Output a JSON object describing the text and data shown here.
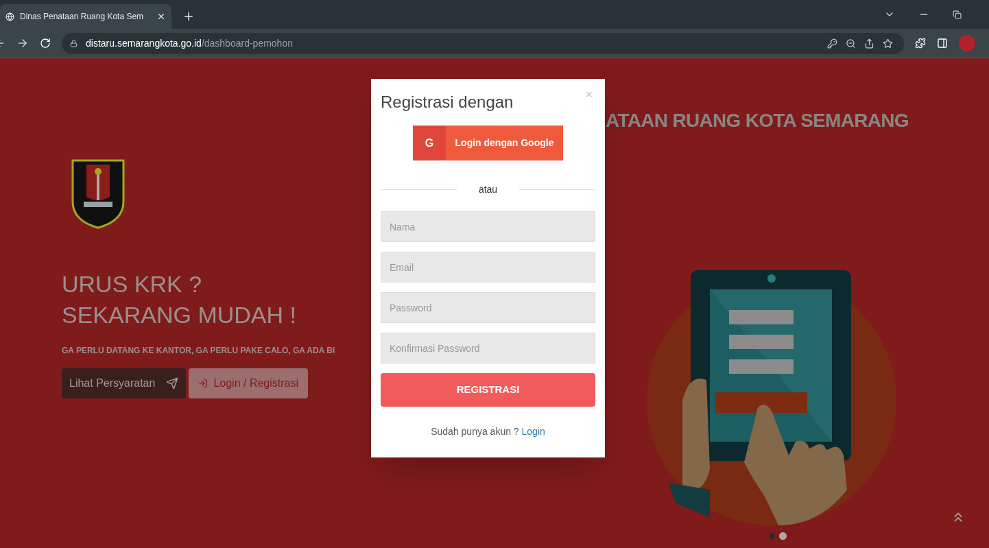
{
  "browser": {
    "tab": {
      "title": "Dinas Penataan Ruang Kota Sem"
    },
    "address": {
      "domain": "distaru.semarangkota.go.id",
      "path": "/dashboard-pemohon"
    }
  },
  "page": {
    "heading_lines": [
      "URUS KRK ?",
      "SEKARANG MUDAH !"
    ],
    "tagline": "GA PERLU DATANG KE KANTOR, GA PERLU PAKE CALO, GA ADA BI",
    "buttons": [
      {
        "label": "Lihat Persyaratan",
        "kind": "primary"
      },
      {
        "label": "Login / Registrasi",
        "kind": "secondary"
      }
    ],
    "title": "ATAAN RUANG KOTA SEMARANG",
    "carousel": [
      {
        "selected": false
      },
      {
        "selected": true
      }
    ]
  },
  "modal": {
    "title": "Registrasi dengan",
    "close": "×",
    "google_button": {
      "icon": "G",
      "label": "Login dengan Google"
    },
    "divider": "atau",
    "fields": [
      {
        "placeholder": "Nama"
      },
      {
        "placeholder": "Email"
      },
      {
        "placeholder": "Password"
      },
      {
        "placeholder": "Konfirmasi Password"
      }
    ],
    "submit": "REGISTRASI",
    "footer": {
      "text": "Sudah punya akun ?",
      "link": "Login"
    }
  }
}
